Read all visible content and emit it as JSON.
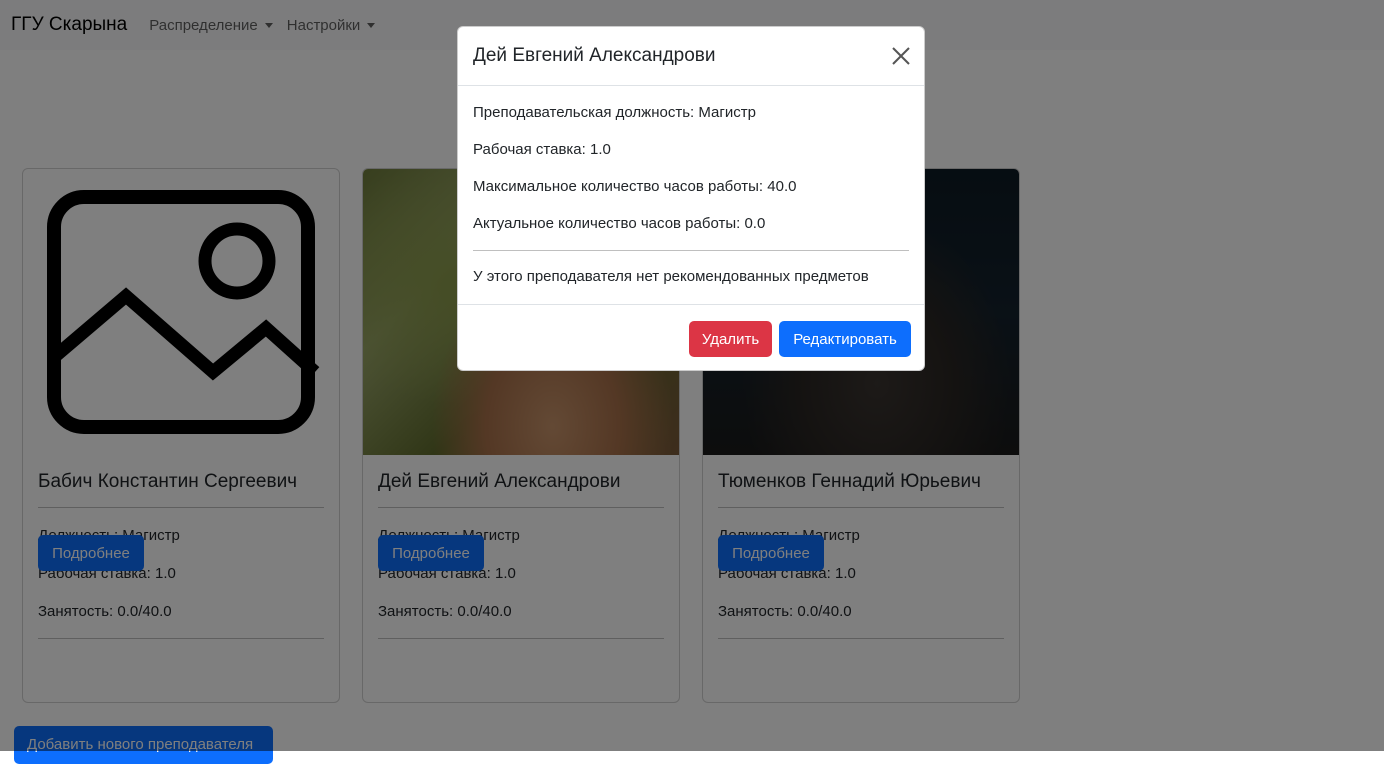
{
  "navbar": {
    "brand": "ГГУ Скарына",
    "menu": [
      {
        "label": "Распределение"
      },
      {
        "label": "Настройки"
      }
    ]
  },
  "cards": [
    {
      "name": "Бабич Константин Сергеевич",
      "position": "Должность: Магистр",
      "rate": "Рабочая ставка: 1.0",
      "load": "Занятость: 0.0/40.0",
      "details_label": "Подробнее",
      "image": "image-placeholder-icon"
    },
    {
      "name": "Дей Евгений Александрови",
      "position": "Должность: Магистр",
      "rate": "Рабочая ставка: 1.0",
      "load": "Занятость: 0.0/40.0",
      "details_label": "Подробнее",
      "image": "teacher-photo"
    },
    {
      "name": "Тюменков Геннадий Юрьевич",
      "position": "Должность: Магистр",
      "rate": "Рабочая ставка: 1.0",
      "load": "Занятость: 0.0/40.0",
      "details_label": "Подробнее",
      "image": "teacher-photo"
    }
  ],
  "add_teacher_label": "Добавить нового преподавателя",
  "modal": {
    "title": "Дей Евгений Александрови",
    "close_icon": "close-icon",
    "position": "Преподавательская должность: Магистр",
    "rate": "Рабочая ставка: 1.0",
    "max_hours": "Максимальное количество часов работы: 40.0",
    "actual_hours": "Актуальное количество часов работы: 0.0",
    "recommended": "У этого преподавателя нет рекомендованных предметов",
    "delete_label": "Удалить",
    "edit_label": "Редактировать"
  },
  "colors": {
    "primary": "#0d6efd",
    "danger": "#dc3545",
    "navbar_bg": "#f8f9fa",
    "backdrop": "rgba(0,0,0,0.5)"
  }
}
